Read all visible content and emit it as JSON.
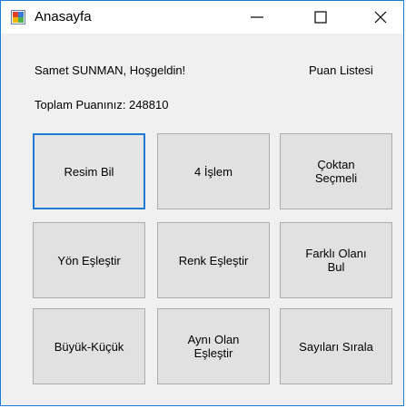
{
  "window": {
    "title": "Anasayfa",
    "accent_color": "#1f7ad6",
    "icon": "app-window-icon",
    "controls": {
      "minimize_icon": "minimize-icon",
      "maximize_icon": "maximize-icon",
      "close_icon": "close-icon"
    }
  },
  "header": {
    "welcome_text": "Samet SUNMAN, Hoşgeldin!",
    "points_text": "Toplam Puanınız: 248810",
    "leaderboard_link": "Puan Listesi"
  },
  "games": [
    "Resim Bil",
    "4 İşlem",
    "Çoktan\nSeçmeli",
    "Yön Eşleştir",
    "Renk Eşleştir",
    "Farklı Olanı\nBul",
    "Büyük-Küçük",
    "Aynı Olan\nEşleştir",
    "Sayıları Sırala"
  ]
}
